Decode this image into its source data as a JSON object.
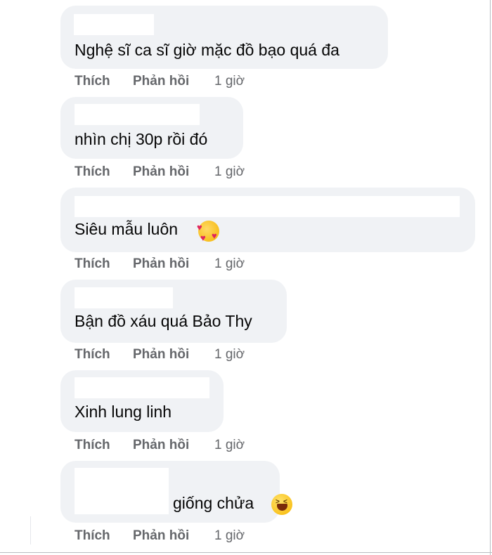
{
  "comments": [
    {
      "text": "Nghệ sĩ ca sĩ giờ mặc đồ bạo quá đa",
      "like": "Thích",
      "reply": "Phản hồi",
      "time": "1 giờ"
    },
    {
      "text": "nhìn chị 30p rồi đó",
      "like": "Thích",
      "reply": "Phản hồi",
      "time": "1 giờ"
    },
    {
      "text": "Siêu mẫu luôn",
      "emoji": "smiling-face-with-hearts-icon",
      "like": "Thích",
      "reply": "Phản hồi",
      "time": "1 giờ"
    },
    {
      "text": "Bận đồ xáu quá Bảo Thy",
      "like": "Thích",
      "reply": "Phản hồi",
      "time": "1 giờ"
    },
    {
      "text": "Xinh lung linh",
      "like": "Thích",
      "reply": "Phản hồi",
      "time": "1 giờ"
    },
    {
      "text": "giống chửa",
      "emoji": "grinning-squinting-face-icon",
      "like": "Thích",
      "reply": "Phản hồi",
      "time": "1 giờ"
    }
  ],
  "colors": {
    "bubble": "#f0f2f5",
    "text": "#050505",
    "meta": "#65676b"
  }
}
